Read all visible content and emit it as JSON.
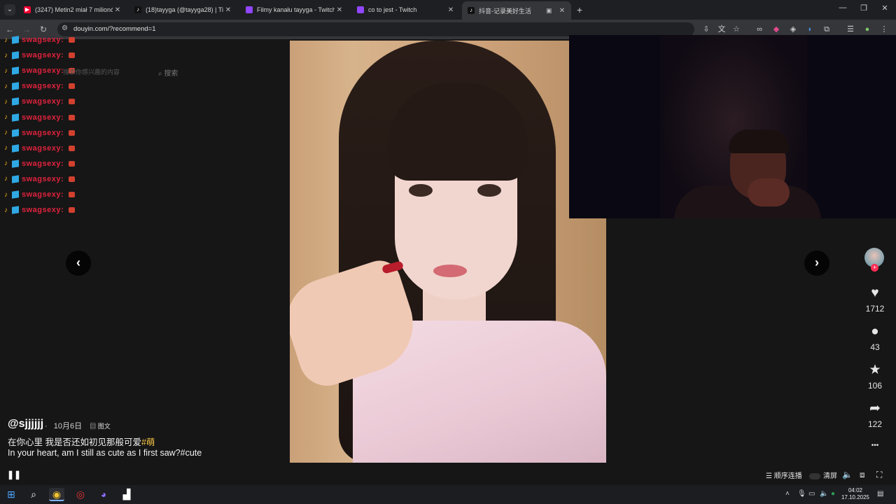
{
  "browser": {
    "tabs": [
      {
        "title": "(3247) Metin2 miał 7 milionów",
        "favicon": "youtube-icon",
        "color": "#ff0033"
      },
      {
        "title": "(18)tayyga (@tayyga28) | TikTok",
        "favicon": "tiktok-icon",
        "color": "#111111"
      },
      {
        "title": "Filmy kanału tayyga - Twitch",
        "favicon": "twitch-icon",
        "color": "#9146ff"
      },
      {
        "title": "co to jest - Twitch",
        "favicon": "twitch-icon",
        "color": "#9146ff"
      },
      {
        "title": "抖音-记录美好生活",
        "favicon": "douyin-icon",
        "color": "#111111",
        "active": true
      }
    ],
    "url": "douyin.com/?recommend=1"
  },
  "chat": {
    "username": "swagsexy:",
    "lines": 12
  },
  "search": {
    "placeholder": "搜索你感兴趣的内容",
    "button": "搜索"
  },
  "video": {
    "author": "@sjjjjjj",
    "separator": "·",
    "date": "10月6日",
    "type_tag": "图文",
    "caption_cn": "在你心里 我是否还如初见那般可爱",
    "hashtag": "#萌",
    "caption_en": "In your heart, am I still as cute as I first saw?#cute"
  },
  "actions": {
    "likes": "1712",
    "comments": "43",
    "favorites": "106",
    "shares": "122",
    "more": "•••"
  },
  "playbar": {
    "autoplay_label": "顺序连播",
    "clear_label": "清屏"
  },
  "nav": {
    "prev": "‹",
    "next": "›"
  },
  "taskbar": {
    "time": "04:02",
    "date": "17.10.2025"
  },
  "colors": {
    "chat_name": "#e0223d",
    "hashtag": "#f6c344",
    "follow_plus": "#fe2c55"
  }
}
